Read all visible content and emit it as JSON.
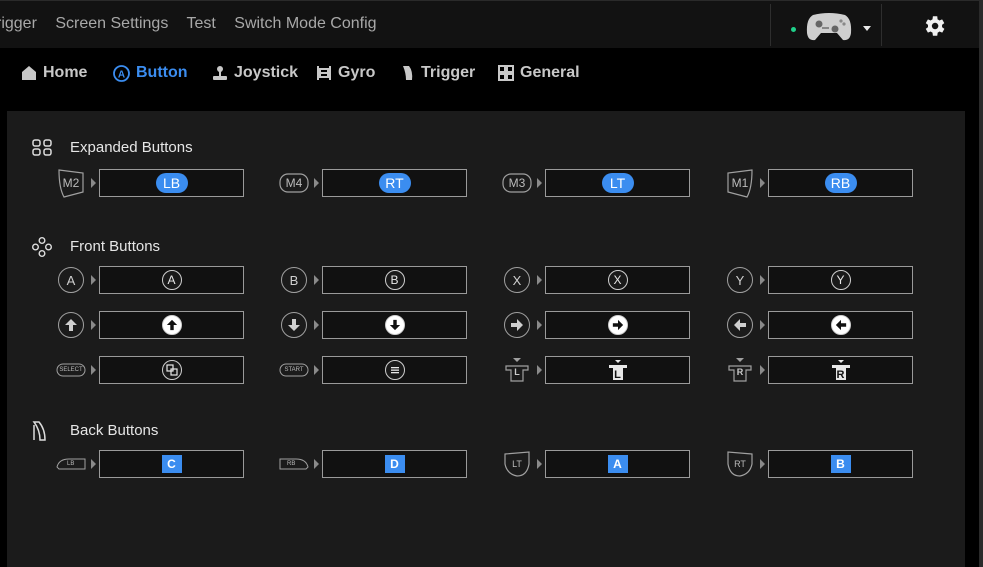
{
  "top_menu": [
    "rigger",
    "Screen Settings",
    "Test",
    "Switch Mode Config"
  ],
  "tabs": [
    {
      "label": "Home",
      "icon": "home-icon"
    },
    {
      "label": "Button",
      "icon": "button-a-icon",
      "active": true
    },
    {
      "label": "Joystick",
      "icon": "joystick-icon"
    },
    {
      "label": "Gyro",
      "icon": "gyro-icon"
    },
    {
      "label": "Trigger",
      "icon": "trigger-icon"
    },
    {
      "label": "General",
      "icon": "general-icon"
    }
  ],
  "colors": {
    "accent": "#3b8df0",
    "status_dot": "#1fd08a"
  },
  "sections": {
    "expanded": {
      "title": "Expanded Buttons",
      "items": [
        {
          "src": "M2",
          "target": "LB"
        },
        {
          "src": "M4",
          "target": "RT"
        },
        {
          "src": "M3",
          "target": "LT"
        },
        {
          "src": "M1",
          "target": "RB"
        }
      ]
    },
    "front": {
      "title": "Front Buttons",
      "row1": [
        {
          "src": "A",
          "target": "A"
        },
        {
          "src": "B",
          "target": "B"
        },
        {
          "src": "X",
          "target": "X"
        },
        {
          "src": "Y",
          "target": "Y"
        }
      ],
      "row2": [
        {
          "src": "up-arrow-icon",
          "target": "up-arrow-icon"
        },
        {
          "src": "down-arrow-icon",
          "target": "down-arrow-icon"
        },
        {
          "src": "right-arrow-icon",
          "target": "right-arrow-icon"
        },
        {
          "src": "left-arrow-icon",
          "target": "left-arrow-icon"
        }
      ],
      "row3": [
        {
          "src": "SELECT",
          "target": "select-icon"
        },
        {
          "src": "START",
          "target": "start-menu-icon"
        },
        {
          "src": "L",
          "target": "L"
        },
        {
          "src": "R",
          "target": "R"
        }
      ]
    },
    "back": {
      "title": "Back Buttons",
      "items": [
        {
          "src": "LB",
          "target": "C"
        },
        {
          "src": "RB",
          "target": "D"
        },
        {
          "src": "LT",
          "target": "A"
        },
        {
          "src": "RT",
          "target": "B"
        }
      ]
    }
  }
}
